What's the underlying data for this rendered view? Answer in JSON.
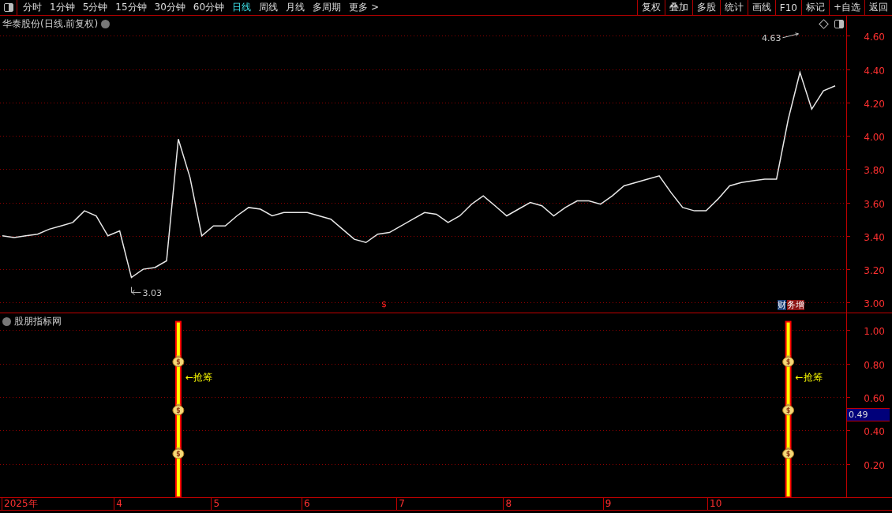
{
  "toolbar": {
    "tabs": [
      {
        "label": "分时",
        "selected": false
      },
      {
        "label": "1分钟",
        "selected": false
      },
      {
        "label": "5分钟",
        "selected": false
      },
      {
        "label": "15分钟",
        "selected": false
      },
      {
        "label": "30分钟",
        "selected": false
      },
      {
        "label": "60分钟",
        "selected": false
      },
      {
        "label": "日线",
        "selected": true
      },
      {
        "label": "周线",
        "selected": false
      },
      {
        "label": "月线",
        "selected": false
      },
      {
        "label": "多周期",
        "selected": false
      },
      {
        "label": "更多 >",
        "selected": false
      }
    ],
    "buttons": [
      "复权",
      "叠加",
      "多股",
      "统计",
      "画线",
      "F10",
      "标记",
      "+自选",
      "返回"
    ]
  },
  "main_chart": {
    "title": "华泰股份(日线.前复权)",
    "events": [
      {
        "kind": "symbol",
        "text": "$"
      },
      {
        "kind": "badge",
        "parts": [
          {
            "text": "财",
            "color": "#1c3f78"
          },
          {
            "text": "务增",
            "color": "#8c1414"
          }
        ]
      }
    ],
    "chart_data": {
      "type": "line",
      "grid": true,
      "ylim": [
        2.94,
        4.72
      ],
      "yticks": [
        {
          "value": 3.0,
          "label": "3.00"
        },
        {
          "value": 3.2,
          "label": "3.20"
        },
        {
          "value": 3.4,
          "label": "3.40"
        },
        {
          "value": 3.6,
          "label": "3.60"
        },
        {
          "value": 3.8,
          "label": "3.80"
        },
        {
          "value": 4.0,
          "label": "4.00"
        },
        {
          "value": 4.2,
          "label": "4.20"
        },
        {
          "value": 4.4,
          "label": "4.40"
        },
        {
          "value": 4.6,
          "label": "4.60"
        }
      ],
      "series": [
        {
          "color": "#e8e8e8",
          "values": [
            3.4,
            3.39,
            3.4,
            3.41,
            3.44,
            3.46,
            3.48,
            3.55,
            3.52,
            3.4,
            3.43,
            3.15,
            3.2,
            3.21,
            3.25,
            3.98,
            3.75,
            3.4,
            3.46,
            3.46,
            3.52,
            3.57,
            3.56,
            3.52,
            3.54,
            3.54,
            3.54,
            3.52,
            3.5,
            3.44,
            3.38,
            3.36,
            3.41,
            3.42,
            3.46,
            3.5,
            3.54,
            3.53,
            3.48,
            3.52,
            3.59,
            3.64,
            3.58,
            3.52,
            3.56,
            3.6,
            3.58,
            3.52,
            3.57,
            3.61,
            3.61,
            3.59,
            3.64,
            3.7,
            3.72,
            3.74,
            3.76,
            3.66,
            3.57,
            3.55,
            3.55,
            3.62,
            3.7,
            3.72,
            3.73,
            3.74,
            3.74,
            4.1,
            4.38,
            4.16,
            4.27,
            4.3
          ]
        }
      ],
      "annotations": [
        {
          "text": "4.63"
        },
        {
          "text": "3.03"
        }
      ]
    }
  },
  "indicator": {
    "title": "股朋指标网",
    "reading": "0.49",
    "chart_data": {
      "type": "bar",
      "grid": true,
      "ylim": [
        0,
        1.1
      ],
      "yticks": [
        {
          "value": 0.2,
          "label": "0.20"
        },
        {
          "value": 0.4,
          "label": "0.40"
        },
        {
          "value": 0.6,
          "label": "0.60"
        },
        {
          "value": 0.8,
          "label": "0.80"
        },
        {
          "value": 1.0,
          "label": "1.00"
        }
      ],
      "series": [
        {
          "color": "#ffff00",
          "values": [
            null,
            null,
            null,
            null,
            null,
            null,
            null,
            null,
            null,
            null,
            null,
            null,
            null,
            null,
            null,
            1.05,
            null,
            null,
            null,
            null,
            null,
            null,
            null,
            null,
            null,
            null,
            null,
            null,
            null,
            null,
            null,
            null,
            null,
            null,
            null,
            null,
            null,
            null,
            null,
            null,
            null,
            null,
            null,
            null,
            null,
            null,
            null,
            null,
            null,
            null,
            null,
            null,
            null,
            null,
            null,
            null,
            null,
            null,
            null,
            null,
            null,
            null,
            null,
            null,
            null,
            null,
            null,
            1.05,
            null,
            null,
            null,
            null
          ]
        }
      ],
      "annotations": [
        {
          "text": "←抢筹"
        },
        {
          "text": "←抢筹"
        }
      ]
    }
  },
  "date_axis": [
    "2025年",
    "4",
    "5",
    "6",
    "7",
    "8",
    "9",
    "10"
  ]
}
